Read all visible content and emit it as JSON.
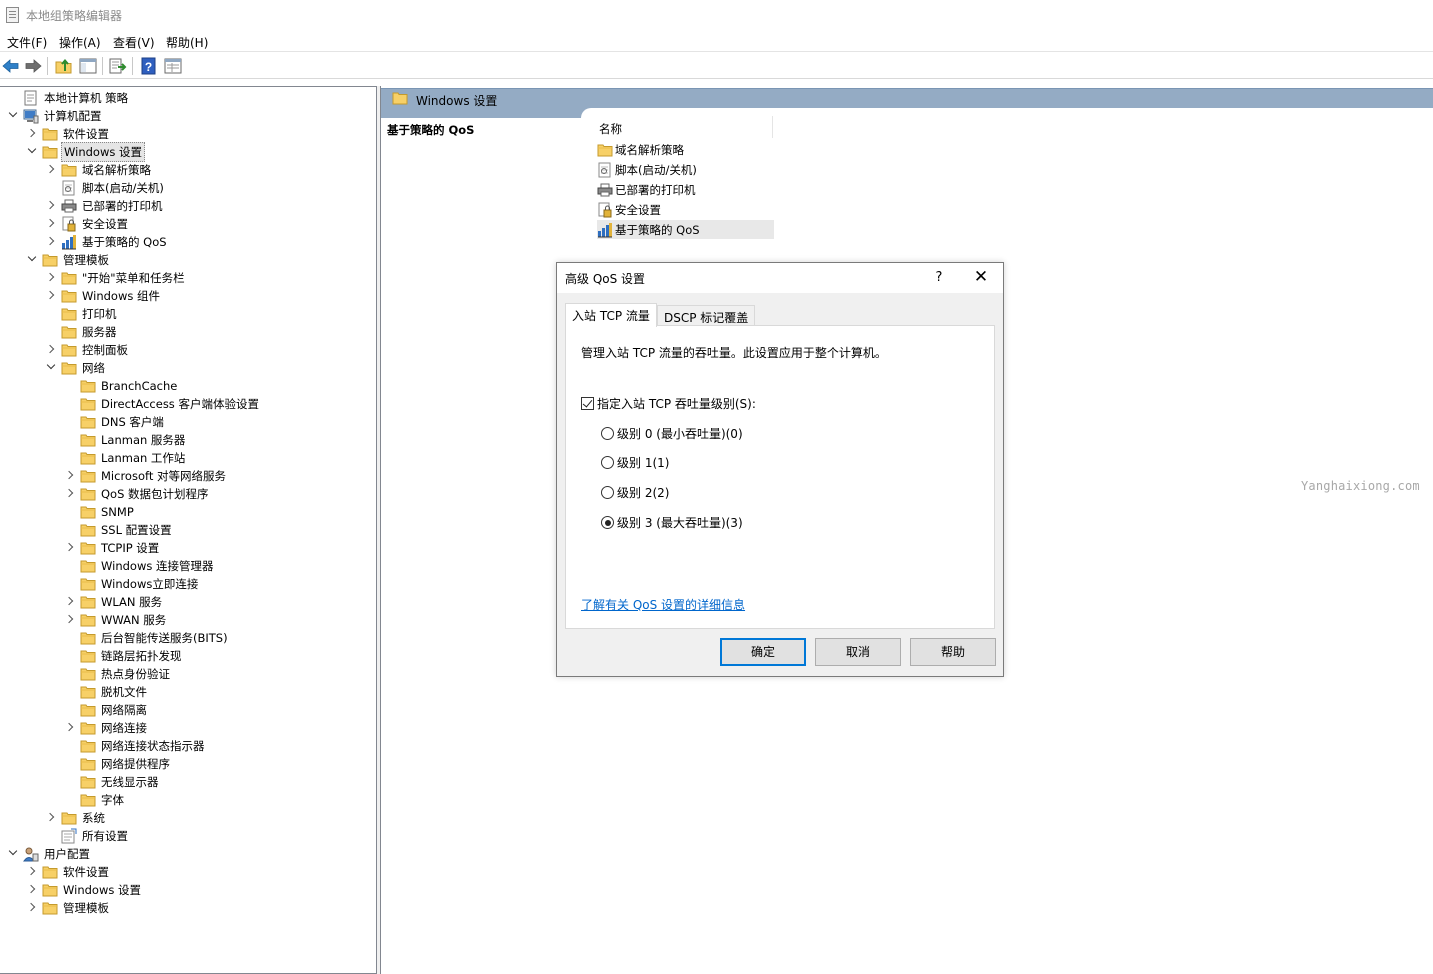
{
  "window": {
    "title": "本地组策略编辑器"
  },
  "menu": [
    "文件(F)",
    "操作(A)",
    "查看(V)",
    "帮助(H)"
  ],
  "toolbar": [
    "back-icon",
    "forward-icon",
    "up-folder-icon",
    "show-hide-tree-icon",
    "export-list-icon",
    "help-icon",
    "properties-view-icon"
  ],
  "tree": {
    "rows": [
      {
        "label": "本地计算机 策略",
        "level": 0,
        "exp": "none",
        "icon": "policy"
      },
      {
        "label": "计算机配置",
        "level": 0,
        "exp": "expanded",
        "icon": "computer"
      },
      {
        "label": "软件设置",
        "level": 1,
        "exp": "collapsed",
        "icon": "folder"
      },
      {
        "label": "Windows 设置",
        "level": 1,
        "exp": "expanded",
        "icon": "folder",
        "selected": true
      },
      {
        "label": "域名解析策略",
        "level": 2,
        "exp": "collapsed",
        "icon": "folder"
      },
      {
        "label": "脚本(启动/关机)",
        "level": 2,
        "exp": "none",
        "icon": "script"
      },
      {
        "label": "已部署的打印机",
        "level": 2,
        "exp": "collapsed",
        "icon": "printer"
      },
      {
        "label": "安全设置",
        "level": 2,
        "exp": "collapsed",
        "icon": "security"
      },
      {
        "label": "基于策略的 QoS",
        "level": 2,
        "exp": "collapsed",
        "icon": "qos"
      },
      {
        "label": "管理模板",
        "level": 1,
        "exp": "expanded",
        "icon": "folder"
      },
      {
        "label": "\"开始\"菜单和任务栏",
        "level": 2,
        "exp": "collapsed",
        "icon": "folder"
      },
      {
        "label": "Windows 组件",
        "level": 2,
        "exp": "collapsed",
        "icon": "folder"
      },
      {
        "label": "打印机",
        "level": 2,
        "exp": "none",
        "icon": "folder"
      },
      {
        "label": "服务器",
        "level": 2,
        "exp": "none",
        "icon": "folder"
      },
      {
        "label": "控制面板",
        "level": 2,
        "exp": "collapsed",
        "icon": "folder"
      },
      {
        "label": "网络",
        "level": 2,
        "exp": "expanded",
        "icon": "folder"
      },
      {
        "label": "BranchCache",
        "level": 3,
        "exp": "none",
        "icon": "folder"
      },
      {
        "label": "DirectAccess 客户端体验设置",
        "level": 3,
        "exp": "none",
        "icon": "folder"
      },
      {
        "label": "DNS 客户端",
        "level": 3,
        "exp": "none",
        "icon": "folder"
      },
      {
        "label": "Lanman 服务器",
        "level": 3,
        "exp": "none",
        "icon": "folder"
      },
      {
        "label": "Lanman 工作站",
        "level": 3,
        "exp": "none",
        "icon": "folder"
      },
      {
        "label": "Microsoft 对等网络服务",
        "level": 3,
        "exp": "collapsed",
        "icon": "folder"
      },
      {
        "label": "QoS 数据包计划程序",
        "level": 3,
        "exp": "collapsed",
        "icon": "folder"
      },
      {
        "label": "SNMP",
        "level": 3,
        "exp": "none",
        "icon": "folder"
      },
      {
        "label": "SSL 配置设置",
        "level": 3,
        "exp": "none",
        "icon": "folder"
      },
      {
        "label": "TCPIP 设置",
        "level": 3,
        "exp": "collapsed",
        "icon": "folder"
      },
      {
        "label": "Windows 连接管理器",
        "level": 3,
        "exp": "none",
        "icon": "folder"
      },
      {
        "label": "Windows立即连接",
        "level": 3,
        "exp": "none",
        "icon": "folder"
      },
      {
        "label": "WLAN 服务",
        "level": 3,
        "exp": "collapsed",
        "icon": "folder"
      },
      {
        "label": "WWAN 服务",
        "level": 3,
        "exp": "collapsed",
        "icon": "folder"
      },
      {
        "label": "后台智能传送服务(BITS)",
        "level": 3,
        "exp": "none",
        "icon": "folder"
      },
      {
        "label": "链路层拓扑发现",
        "level": 3,
        "exp": "none",
        "icon": "folder"
      },
      {
        "label": "热点身份验证",
        "level": 3,
        "exp": "none",
        "icon": "folder"
      },
      {
        "label": "脱机文件",
        "level": 3,
        "exp": "none",
        "icon": "folder"
      },
      {
        "label": "网络隔离",
        "level": 3,
        "exp": "none",
        "icon": "folder"
      },
      {
        "label": "网络连接",
        "level": 3,
        "exp": "collapsed",
        "icon": "folder"
      },
      {
        "label": "网络连接状态指示器",
        "level": 3,
        "exp": "none",
        "icon": "folder"
      },
      {
        "label": "网络提供程序",
        "level": 3,
        "exp": "none",
        "icon": "folder"
      },
      {
        "label": "无线显示器",
        "level": 3,
        "exp": "none",
        "icon": "folder"
      },
      {
        "label": "字体",
        "level": 3,
        "exp": "none",
        "icon": "folder"
      },
      {
        "label": "系统",
        "level": 2,
        "exp": "collapsed",
        "icon": "folder"
      },
      {
        "label": "所有设置",
        "level": 2,
        "exp": "none",
        "icon": "all-settings"
      },
      {
        "label": "用户配置",
        "level": 0,
        "exp": "expanded",
        "icon": "user"
      },
      {
        "label": "软件设置",
        "level": 1,
        "exp": "collapsed",
        "icon": "folder"
      },
      {
        "label": "Windows 设置",
        "level": 1,
        "exp": "collapsed",
        "icon": "folder"
      },
      {
        "label": "管理模板",
        "level": 1,
        "exp": "collapsed",
        "icon": "folder"
      }
    ]
  },
  "right": {
    "header": "Windows 设置",
    "section_title": "基于策略的 QoS",
    "column_name": "名称",
    "items": [
      {
        "label": "域名解析策略",
        "icon": "folder"
      },
      {
        "label": "脚本(启动/关机)",
        "icon": "script"
      },
      {
        "label": "已部署的打印机",
        "icon": "printer"
      },
      {
        "label": "安全设置",
        "icon": "security"
      },
      {
        "label": "基于策略的 QoS",
        "icon": "qos",
        "highlight": true
      }
    ],
    "watermark": "Yanghaixiong.com"
  },
  "dialog": {
    "title": "高级 QoS 设置",
    "help_glyph": "?",
    "close_glyph": "✕",
    "tabs": [
      "入站 TCP 流量",
      "DSCP 标记覆盖"
    ],
    "active_tab": 0,
    "description": "管理入站 TCP 流量的吞吐量。此设置应用于整个计算机。",
    "checkbox_label": "指定入站 TCP 吞吐量级别(S):",
    "checkbox_checked": true,
    "radios": [
      {
        "label": "级别 0 (最小吞吐量)(0)",
        "checked": false
      },
      {
        "label": "级别 1(1)",
        "checked": false
      },
      {
        "label": "级别 2(2)",
        "checked": false
      },
      {
        "label": "级别 3 (最大吞吐量)(3)",
        "checked": true
      }
    ],
    "link": "了解有关 QoS 设置的详细信息",
    "buttons": {
      "ok": "确定",
      "cancel": "取消",
      "help": "帮助"
    }
  },
  "colors": {
    "header_blue": "#94abc4",
    "link": "#0066cc",
    "default_button_border": "#0078d7",
    "folder": "#f7d067"
  }
}
